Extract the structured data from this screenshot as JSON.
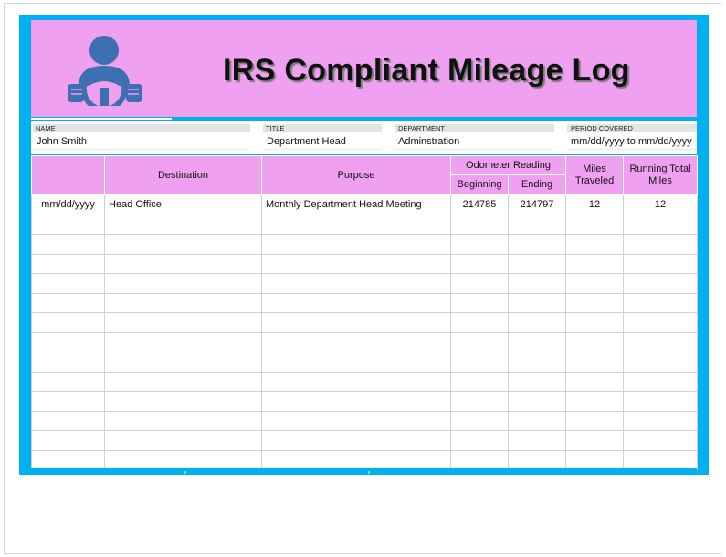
{
  "header": {
    "title": "IRS Compliant Mileage Log",
    "logo_icon": "driver-steering-wheel-icon"
  },
  "colors": {
    "frame": "#00b0f0",
    "header_band": "#f0a0f0"
  },
  "info": {
    "name_label": "NAME",
    "name_value": "John Smith",
    "title_label": "TITLE",
    "title_value": "Department Head",
    "department_label": "DEPARTMENT",
    "department_value": "Adminstration",
    "period_label": "PERIOD COVERED",
    "period_value": "mm/dd/yyyy to mm/dd/yyyy"
  },
  "table": {
    "columns": {
      "date": "",
      "destination": "Destination",
      "purpose": "Purpose",
      "odometer": "Odometer Reading",
      "beginning": "Beginning",
      "ending": "Ending",
      "miles": "Miles Traveled",
      "running_total": "Running Total Miles"
    },
    "rows": [
      [
        "mm/dd/yyyy",
        "Head Office",
        "Monthly Department Head Meeting",
        "214785",
        "214797",
        "12",
        "12"
      ],
      [
        "",
        "",
        "",
        "",
        "",
        "",
        ""
      ],
      [
        "",
        "",
        "",
        "",
        "",
        "",
        ""
      ],
      [
        "",
        "",
        "",
        "",
        "",
        "",
        ""
      ],
      [
        "",
        "",
        "",
        "",
        "",
        "",
        ""
      ],
      [
        "",
        "",
        "",
        "",
        "",
        "",
        ""
      ],
      [
        "",
        "",
        "",
        "",
        "",
        "",
        ""
      ],
      [
        "",
        "",
        "",
        "",
        "",
        "",
        ""
      ],
      [
        "",
        "",
        "",
        "",
        "",
        "",
        ""
      ],
      [
        "",
        "",
        "",
        "",
        "",
        "",
        ""
      ],
      [
        "",
        "",
        "",
        "",
        "",
        "",
        ""
      ],
      [
        "",
        "",
        "",
        "",
        "",
        "",
        ""
      ],
      [
        "",
        "",
        "",
        "",
        "",
        "",
        ""
      ],
      [
        "",
        "",
        "",
        "",
        "",
        "",
        ""
      ]
    ]
  }
}
